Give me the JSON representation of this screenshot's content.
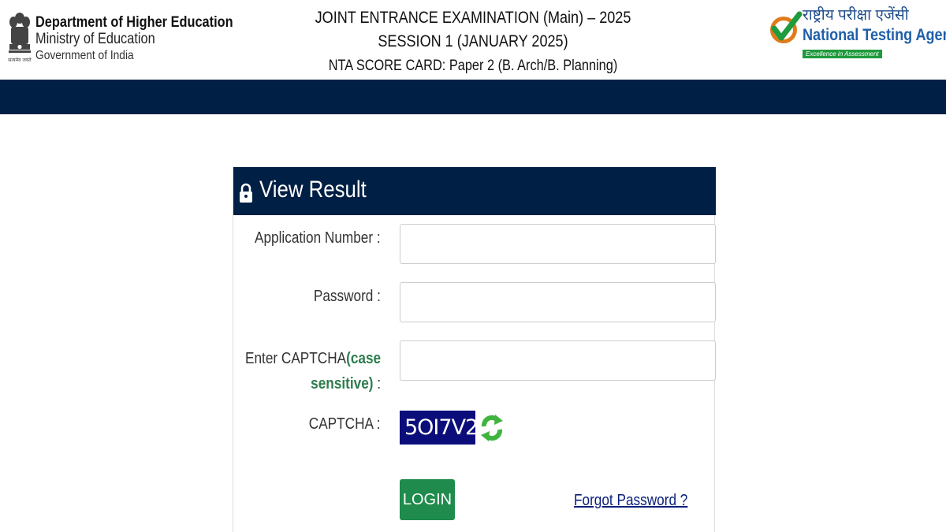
{
  "header": {
    "dept_line1": "Department of Higher Education",
    "dept_line2": "Ministry of Education",
    "dept_line3": "Government of India",
    "emblem_motto": "सत्यमेव जयते",
    "exam_line1": "JOINT ENTRANCE EXAMINATION (Main) – 2025",
    "exam_line2": "SESSION 1 (JANUARY 2025)",
    "exam_line3": "NTA SCORE CARD: Paper 2 (B. Arch/B. Planning)",
    "nta_hindi": "राष्ट्रीय परीक्षा एजेंसी",
    "nta_english": "National Testing Agency",
    "nta_tagline": "Excellence in Assessment"
  },
  "colors": {
    "navy": "#001f44",
    "captcha_bg": "#0b0d7a",
    "login_green": "#1f8b4c",
    "case_green": "#2e7d4f",
    "nta_blue": "#1e5fa8",
    "nta_green": "#1f9a3c"
  },
  "form": {
    "title": "View Result",
    "lock_icon": "lock-icon",
    "application_label": "Application Number :",
    "application_value": "",
    "password_label": "Password :",
    "password_value": "",
    "captcha_input_label_a": "Enter CAPTCHA",
    "captcha_input_label_b": "(case",
    "captcha_input_label_c": "sensitive)",
    "captcha_input_label_d": " :",
    "captcha_input_value": "",
    "captcha_label": "CAPTCHA :",
    "captcha_text": "5OI7V2",
    "refresh_icon": "refresh-icon",
    "login_label": "LOGIN",
    "forgot_label": "Forgot Password ?"
  }
}
